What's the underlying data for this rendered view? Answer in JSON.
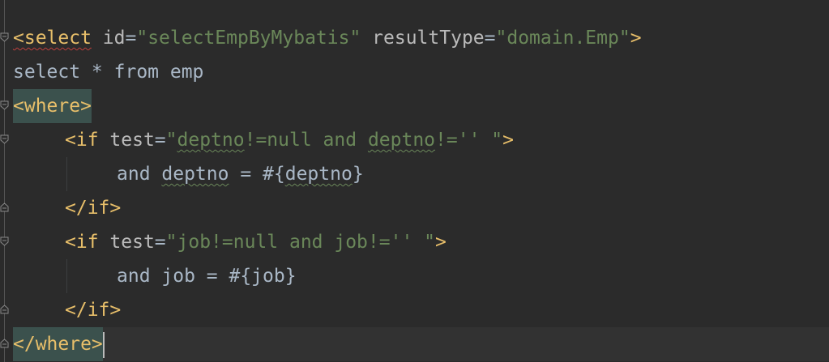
{
  "lines": [
    {
      "tag_open": "<select",
      "attr1_name": "id",
      "eq1": "=",
      "attr1_value": "\"selectEmpByMybatis\"",
      "attr2_name": "resultType",
      "eq2": "=",
      "attr2_value": "\"domain.Emp\"",
      "tag_close": ">"
    },
    {
      "text": "select * from emp"
    },
    {
      "tag": "<where>"
    },
    {
      "tag_open": "<if",
      "attr_name": "test",
      "eq": "=",
      "q_open": "\"",
      "var1": "deptno",
      "mid1": "!=null and ",
      "var2": "deptno",
      "mid2": "!='' ",
      "q_close": "\"",
      "tag_close": ">"
    },
    {
      "kw": "and ",
      "var": "deptno",
      "op": " = #{",
      "param": "deptno",
      "close": "}"
    },
    {
      "tag": "</if>"
    },
    {
      "tag_open": "<if",
      "attr_name": "test",
      "eq": "=",
      "value": "\"job!=null and job!='' \"",
      "tag_close": ">"
    },
    {
      "text": "and job = #{job}"
    },
    {
      "tag": "</if>"
    },
    {
      "tag": "</where>"
    }
  ],
  "colors": {
    "background": "#2b2b2b",
    "tag": "#e8bf6a",
    "string": "#6a8759",
    "text": "#a9b7c6",
    "tag_highlight": "#3b514d"
  }
}
